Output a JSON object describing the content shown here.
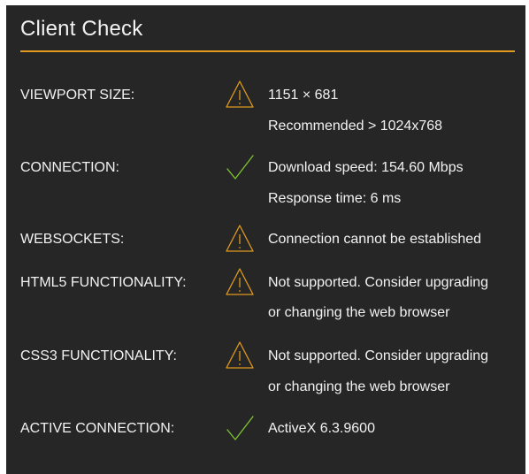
{
  "panel": {
    "title": "Client Check",
    "accent_color": "#e09a1d",
    "ok_color": "#7fc72f"
  },
  "rows": [
    {
      "label": "VIEWPORT SIZE:",
      "status": "warning",
      "icon": "warning-icon",
      "lines": [
        "1151 × 681",
        "Recommended > 1024x768"
      ]
    },
    {
      "label": "CONNECTION:",
      "status": "ok",
      "icon": "check-icon",
      "lines": [
        "Download speed: 154.60 Mbps",
        "Response time: 6 ms"
      ]
    },
    {
      "label": "WEBSOCKETS:",
      "status": "warning",
      "icon": "warning-icon",
      "lines": [
        "Connection cannot be established"
      ]
    },
    {
      "label": "HTML5 FUNCTIONALITY:",
      "status": "warning",
      "icon": "warning-icon",
      "lines": [
        "Not supported. Consider upgrading",
        "or changing the web browser"
      ]
    },
    {
      "label": "CSS3 FUNCTIONALITY:",
      "status": "warning",
      "icon": "warning-icon",
      "lines": [
        "Not supported. Consider upgrading",
        "or changing the web browser"
      ]
    },
    {
      "label": "ACTIVE CONNECTION:",
      "status": "ok",
      "icon": "check-icon",
      "lines": [
        "ActiveX 6.3.9600"
      ]
    }
  ]
}
